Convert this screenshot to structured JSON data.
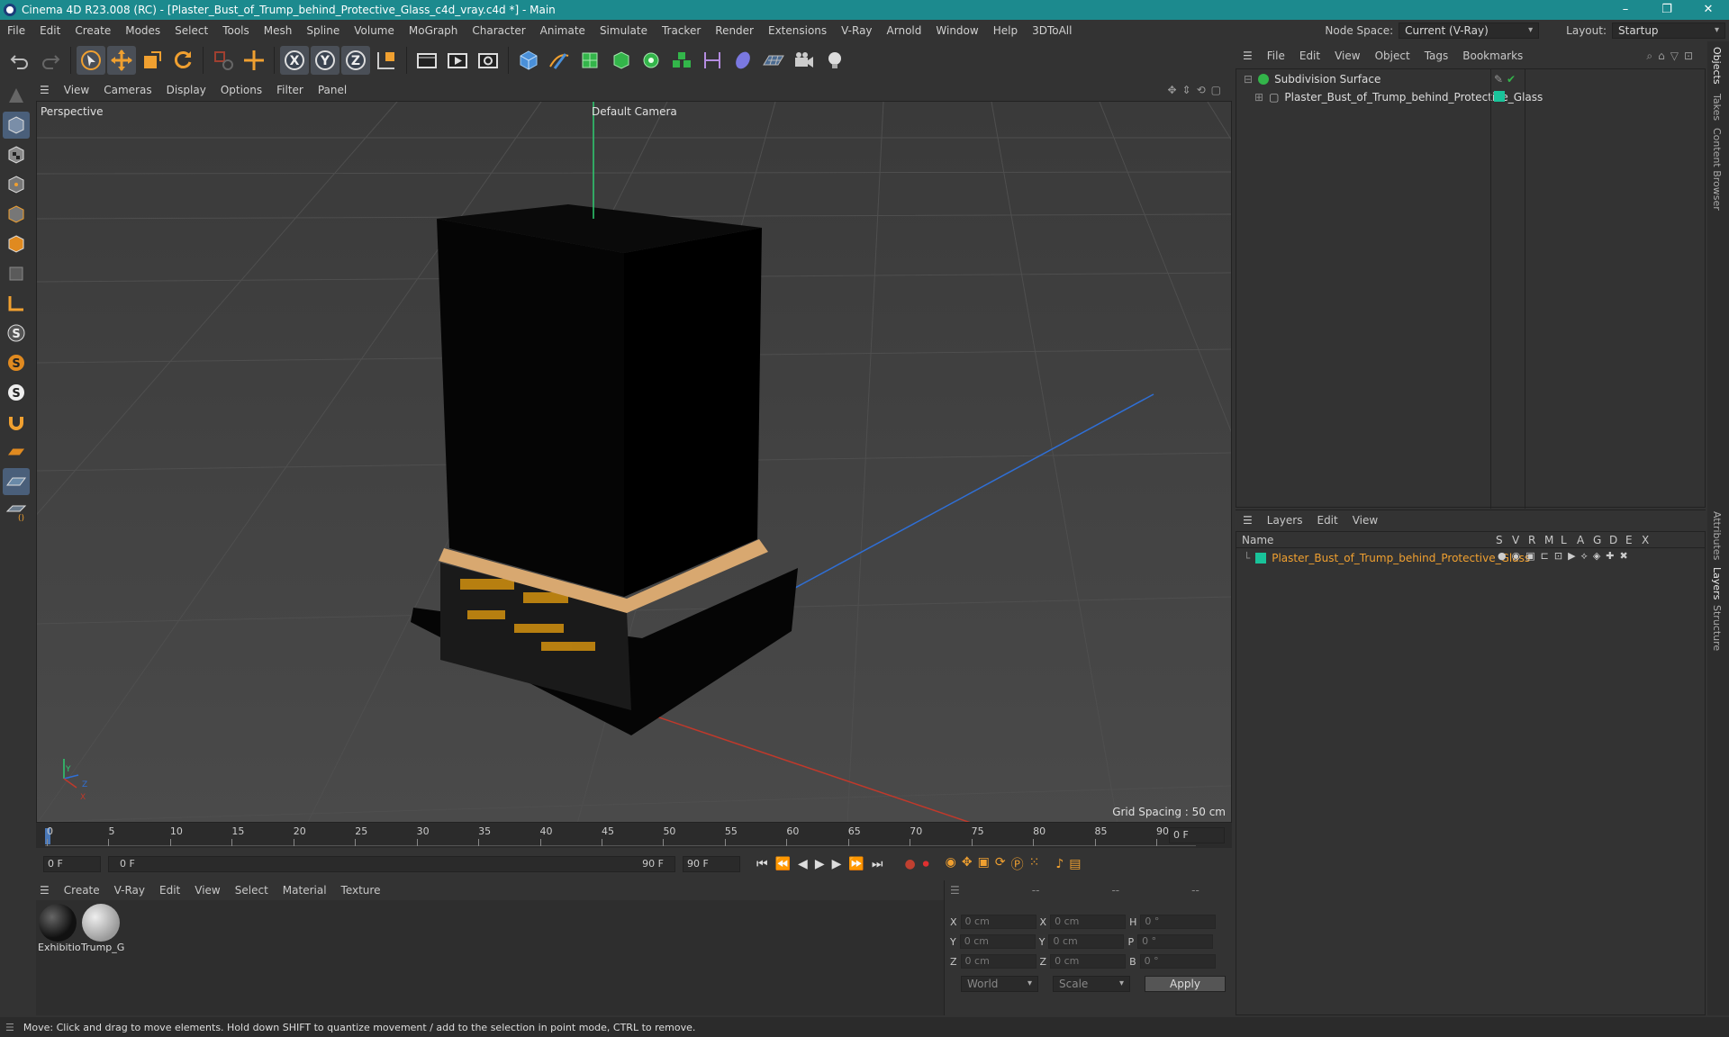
{
  "window": {
    "title": "Cinema 4D R23.008 (RC) - [Plaster_Bust_of_Trump_behind_Protective_Glass_c4d_vray.c4d *] - Main",
    "controls": [
      "–",
      "❐",
      "✕"
    ]
  },
  "menubar": {
    "items": [
      "File",
      "Edit",
      "Create",
      "Modes",
      "Select",
      "Tools",
      "Mesh",
      "Spline",
      "Volume",
      "MoGraph",
      "Character",
      "Animate",
      "Simulate",
      "Tracker",
      "Render",
      "Extensions",
      "V-Ray",
      "Arnold",
      "Window",
      "Help",
      "3DToAll"
    ],
    "node_space_label": "Node Space:",
    "node_space_value": "Current (V-Ray)",
    "layout_label": "Layout:",
    "layout_value": "Startup"
  },
  "toolbar": {
    "icons": [
      "undo-icon",
      "redo-icon",
      "select-icon",
      "move-icon",
      "scale-icon",
      "rotate-icon",
      "recent-tool-icon",
      "live-select-icon",
      "x-axis-icon",
      "y-axis-icon",
      "z-axis-icon",
      "coordinate-system-icon",
      "render-region-icon",
      "render-view-icon",
      "render-settings-icon",
      "cube-icon",
      "pen-icon",
      "subdivision-icon",
      "extrude-icon",
      "cloner-icon",
      "array-icon",
      "symmetry-icon",
      "deformer-icon",
      "floor-icon",
      "camera-icon",
      "light-icon"
    ]
  },
  "viewport": {
    "menu": [
      "View",
      "Cameras",
      "Display",
      "Options",
      "Filter",
      "Panel"
    ],
    "view_name": "Perspective",
    "camera_name": "Default Camera",
    "grid_spacing": "Grid Spacing : 50 cm",
    "axis_labels": {
      "y": "Y",
      "z": "Z",
      "x": "X"
    }
  },
  "timeline": {
    "ticks": [
      "0",
      "5",
      "10",
      "15",
      "20",
      "25",
      "30",
      "35",
      "40",
      "45",
      "50",
      "55",
      "60",
      "65",
      "70",
      "75",
      "80",
      "85",
      "90"
    ],
    "current_frame": "0 F",
    "start_field": "0 F",
    "range_start": "0 F",
    "range_end": "90 F",
    "end_field": "90 F"
  },
  "material_manager": {
    "menu": [
      "Create",
      "V-Ray",
      "Edit",
      "View",
      "Select",
      "Material",
      "Texture"
    ],
    "materials": [
      {
        "name": "Exhibitio",
        "color": "#1a1a1a"
      },
      {
        "name": "Trump_G",
        "color": "#bdbdbd"
      }
    ]
  },
  "coordinates": {
    "headers": [
      "--",
      "--",
      "--"
    ],
    "rows": [
      {
        "a": "X",
        "av": "0 cm",
        "b": "X",
        "bv": "0 cm",
        "c": "H",
        "cv": "0 °"
      },
      {
        "a": "Y",
        "av": "0 cm",
        "b": "Y",
        "bv": "0 cm",
        "c": "P",
        "cv": "0 °"
      },
      {
        "a": "Z",
        "av": "0 cm",
        "b": "Z",
        "bv": "0 cm",
        "c": "B",
        "cv": "0 °"
      }
    ],
    "world": "World",
    "scale": "Scale",
    "apply": "Apply"
  },
  "objects": {
    "menu": [
      "File",
      "Edit",
      "View",
      "Object",
      "Tags",
      "Bookmarks"
    ],
    "items": [
      {
        "name": "Subdivision Surface"
      },
      {
        "name": "Plaster_Bust_of_Trump_behind_Protective_Glass"
      }
    ]
  },
  "layers": {
    "menu": [
      "Layers",
      "Edit",
      "View"
    ],
    "col_name": "Name",
    "cols": [
      "S",
      "V",
      "R",
      "M",
      "L",
      "A",
      "G",
      "D",
      "E",
      "X"
    ],
    "items": [
      {
        "name": "Plaster_Bust_of_Trump_behind_Protective_Glass",
        "color": "#19c39a"
      }
    ]
  },
  "side_tabs": [
    "Objects",
    "Takes",
    "Content Browser",
    "Attributes",
    "Layers",
    "Structure"
  ],
  "status": {
    "text": "Move: Click and drag to move elements. Hold down SHIFT to quantize movement / add to the selection in point mode, CTRL to remove."
  },
  "colors": {
    "titlebar": "#1c8a8e",
    "accent_orange": "#f0a030",
    "layer_green": "#19c39a",
    "axis_x": "#c0392b",
    "axis_y": "#2ecc71",
    "axis_z": "#2f6fd6"
  }
}
